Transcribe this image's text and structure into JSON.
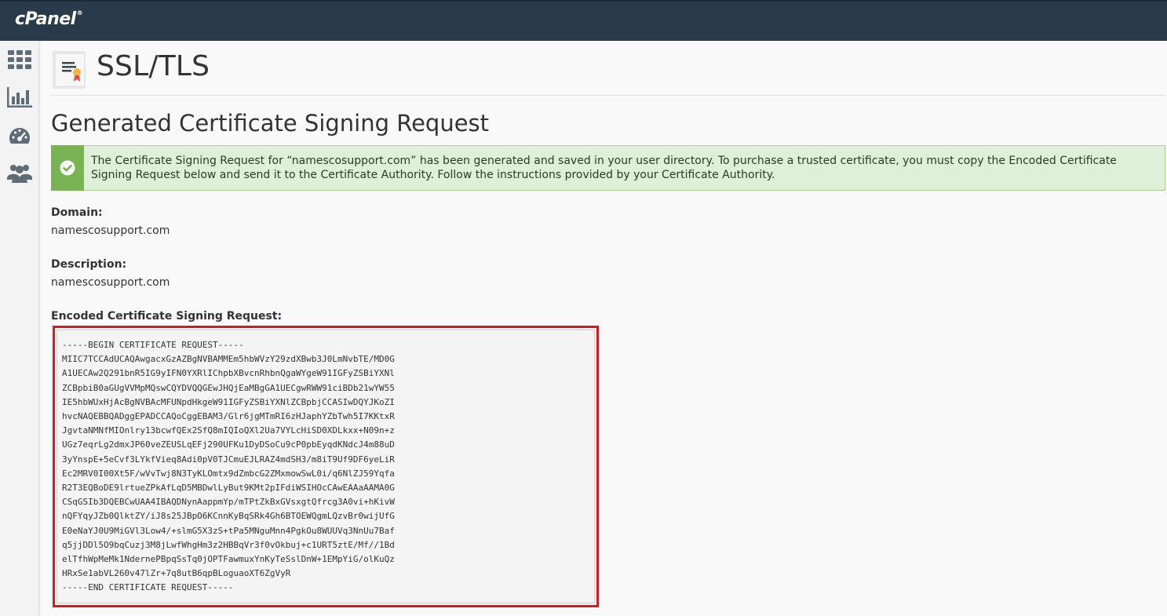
{
  "topbar": {
    "logo": "cPanel",
    "logo_mark": "®"
  },
  "sidebar": {
    "items": [
      {
        "icon": "grid-icon"
      },
      {
        "icon": "bar-chart-icon"
      },
      {
        "icon": "speedometer-icon"
      },
      {
        "icon": "users-icon"
      }
    ]
  },
  "page": {
    "title": "SSL/TLS",
    "icon": "certificate-icon"
  },
  "section": {
    "title": "Generated Certificate Signing Request"
  },
  "alert": {
    "status_color": "#7ab354",
    "message": "The Certificate Signing Request for “namescosupport.com” has been generated and saved in your user directory. To purchase a trusted certificate, you must copy the Encoded Certificate Signing Request below and send it to the Certificate Authority. Follow the instructions provided by your Certificate Authority."
  },
  "domain": {
    "label": "Domain:",
    "value": "namescosupport.com"
  },
  "description": {
    "label": "Description:",
    "value": "namescosupport.com"
  },
  "csr": {
    "label": "Encoded Certificate Signing Request:",
    "text": "-----BEGIN CERTIFICATE REQUEST-----\nMIIC7TCCAdUCAQAwgacxGzAZBgNVBAMMEm5hbWVzY29zdXBwb3J0LmNvbTE/MD0G\nA1UECAw2Q291bnR5IG9yIFN0YXRlIChpbXBvcnRhbnQgaWYgeW91IGFyZSBiYXNl\nZCBpbiB0aGUgVVMpMQswCQYDVQQGEwJHQjEaMBgGA1UECgwRWW91ciBDb21wYW55\nIE5hbWUxHjAcBgNVBAcMFUNpdHkgeW91IGFyZSBiYXNlZCBpbjCCASIwDQYJKoZI\nhvcNAQEBBQADggEPADCCAQoCggEBAM3/Glr6jgMTmRI6zHJaphYZbTwh5I7KKtxR\nJgvtaNMNfMIOnlry13bcwfQEx2SfQ8mIQIoQXl2Ua7VYLcHiSD0XDLkxx+N09n+z\nUGz7eqrLg2dmxJP60veZEUSLqEFj290UFKu1DyDSoCu9cP0pbEyqdKNdcJ4m88uD\n3yYnspE+5eCvf3LYkfVieq8Adi0pV0TJCmuEJLRAZ4mdSH3/m8iT9Uf9DF6yeLiR\nEc2MRV0I00Xt5F/wVvTwj8N3TyKLOmtx9dZmbcG2ZMxmowSwL0i/q6NlZJ59Yqfa\nR2T3EQBoDE9lrtueZPkAfLqD5MBDwlLyBut9KMt2pIFdiWSIHOcCAwEAAaAAMA0G\nCSqGSIb3DQEBCwUAA4IBAQDNynAappmYp/mTPtZkBxGVsxgtQfrcg3A0vi+hKivW\nnQFYqyJZb0QlktZY/iJ8s25JBpO6KCnnKyBqSRk4Gh6BTOEWQgmLQzvBr0wijUfG\nE0eNaYJ0U9MiGVl3Low4/+slmG5X3zS+tPa5MNguMnn4PgkOu8WUUVq3NnUu7Baf\nq5jjDDl5O9bqCuzj3M8jLwfWhgHm3z2HBBqVr3f0vOkbuj+c1URT5ztE/Mf//1Bd\nelTfhWpMeMk1NdernePBpqSsTq0jOPTFawmuxYnKyTeSslDnW+1EMpYiG/olKuQz\nHRxSe1abVL260v47lZr+7q8utB6qpBLoguaoXT6ZgVyR\n-----END CERTIFICATE REQUEST-----",
    "highlight_color": "#d31b20"
  }
}
